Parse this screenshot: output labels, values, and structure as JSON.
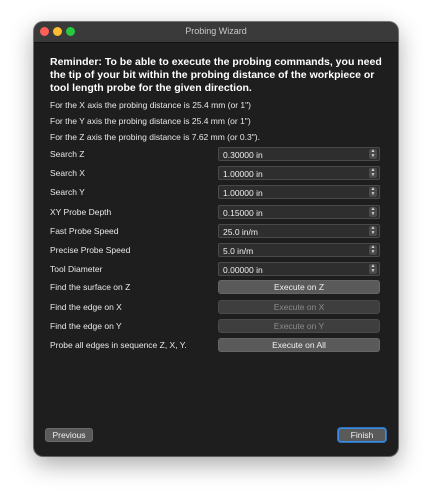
{
  "window": {
    "title": "Probing Wizard"
  },
  "reminder": "Reminder: To be able to execute the probing commands, you need the tip of your bit within the probing distance of the workpiece or tool length probe for the given direction.",
  "info_lines": [
    "For the X axis the probing distance is 25.4 mm (or 1\")",
    "For the Y axis the probing distance is 25.4 mm (or 1\")",
    "For the Z axis the probing distance is 7.62 mm (or 0.3\")."
  ],
  "fields": [
    {
      "label": "Search Z",
      "value": "0.30000 in"
    },
    {
      "label": "Search X",
      "value": "1.00000 in"
    },
    {
      "label": "Search Y",
      "value": "1.00000 in"
    },
    {
      "label": "XY Probe Depth",
      "value": "0.15000 in"
    },
    {
      "label": "Fast Probe Speed",
      "value": "25.0 in/m"
    },
    {
      "label": "Precise Probe Speed",
      "value": "5.0 in/m"
    },
    {
      "label": "Tool Diameter",
      "value": "0.00000 in"
    }
  ],
  "actions": [
    {
      "label": "Find the surface on Z",
      "button": "Execute on Z",
      "enabled": true
    },
    {
      "label": "Find the edge on X",
      "button": "Execute on X",
      "enabled": false
    },
    {
      "label": "Find the edge on Y",
      "button": "Execute on Y",
      "enabled": false
    },
    {
      "label": "Probe all edges in sequence Z, X, Y.",
      "button": "Execute on All",
      "enabled": true
    }
  ],
  "nav": {
    "previous": "Previous",
    "finish": "Finish"
  },
  "icons": {
    "stepper": "up-down-chevron-icon"
  },
  "colors": {
    "background": "#1e1e1e",
    "accent": "#3a8ee6"
  }
}
